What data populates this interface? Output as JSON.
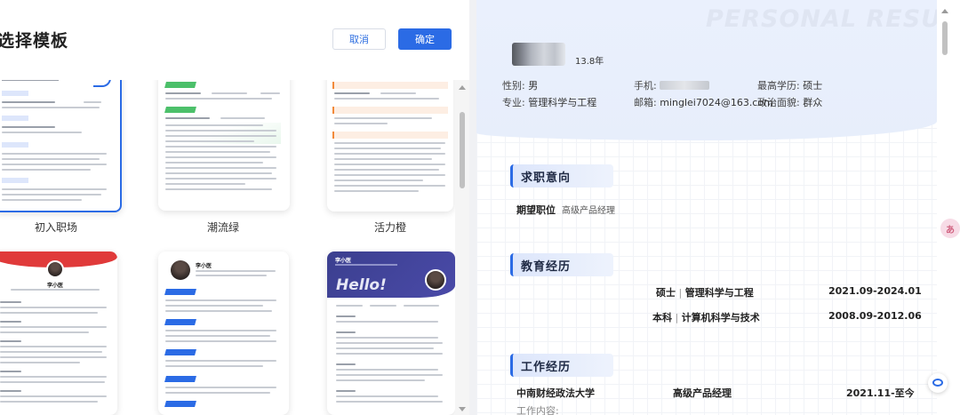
{
  "left": {
    "title": "选择模板",
    "cancel_label": "取消",
    "ok_label": "确定",
    "templates": [
      {
        "name": "初入职场"
      },
      {
        "name": "潮流绿"
      },
      {
        "name": "活力橙"
      },
      {
        "name": "",
        "person": "李小医"
      },
      {
        "name": "",
        "person": "李小医"
      },
      {
        "name": "",
        "person": "李小医",
        "hello": "Hello!"
      }
    ]
  },
  "resume": {
    "watermark": "PERSONAL RESUME",
    "experience": "13.8年",
    "gender_label": "性别:",
    "gender": "男",
    "phone_label": "手机:",
    "edu_label": "最高学历:",
    "edu": "硕士",
    "major_label": "专业:",
    "major": "管理科学与工程",
    "email_label": "邮箱:",
    "email": "minglei7024@163.com",
    "political_label": "政治面貌:",
    "political": "群众",
    "sections": {
      "intent": "求职意向",
      "education": "教育经历",
      "work": "工作经历"
    },
    "intent_label": "期望职位",
    "intent_value": "高级产品经理",
    "education_rows": [
      {
        "degree": "硕士",
        "major": "管理科学与工程",
        "period": "2021.09-2024.01"
      },
      {
        "degree": "本科",
        "major": "计算机科学与技术",
        "period": "2008.09-2012.06"
      }
    ],
    "work_rows": [
      {
        "company": "中南财经政法大学",
        "position": "高级产品经理",
        "period": "2021.11-至今",
        "sub": "工作内容:"
      }
    ]
  },
  "colors": {
    "accent": "#2b6be5",
    "red_banner": "#e03a3a",
    "navy_banner": "#3b3f8f",
    "green": "#4cc06a",
    "orange": "#f28a3b"
  }
}
